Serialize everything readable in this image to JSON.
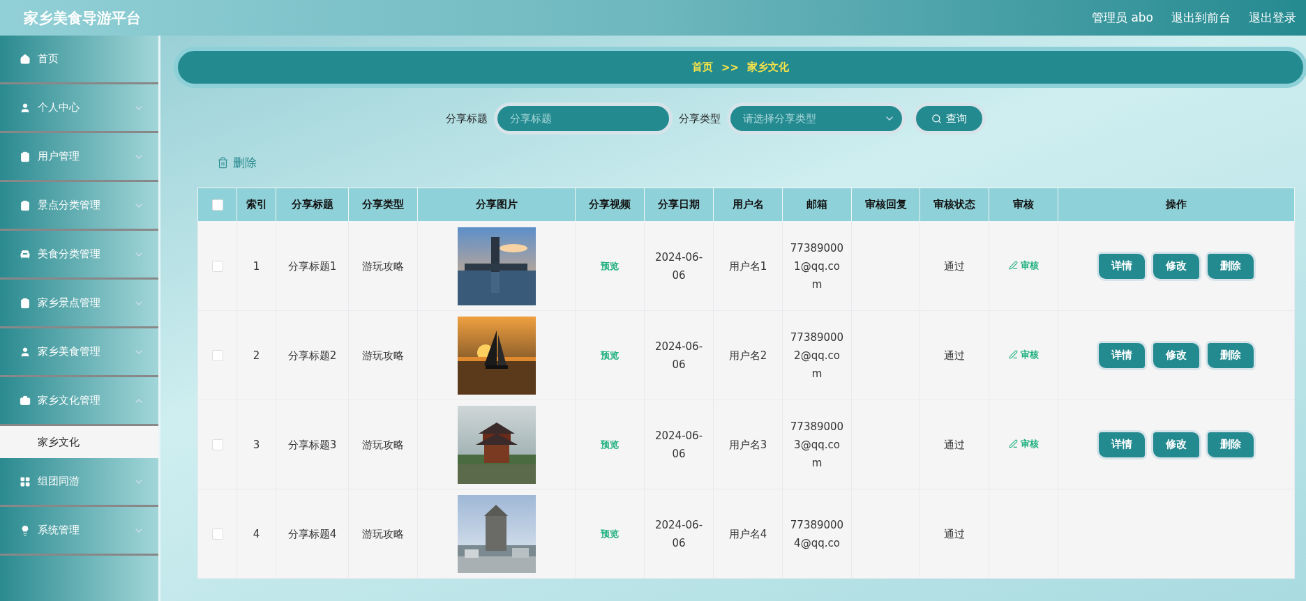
{
  "header": {
    "title": "家乡美食导游平台",
    "user": "管理员 abo",
    "links": [
      "退出到前台",
      "退出登录"
    ]
  },
  "sidebar": {
    "items": [
      {
        "label": "首页",
        "kind": "link",
        "selected": false
      },
      {
        "label": "个人中心",
        "kind": "menu",
        "expanded": false
      },
      {
        "label": "用户管理",
        "kind": "menu",
        "expanded": false
      },
      {
        "label": "景点分类管理",
        "kind": "menu",
        "expanded": false
      },
      {
        "label": "美食分类管理",
        "kind": "menu",
        "expanded": false
      },
      {
        "label": "家乡景点管理",
        "kind": "menu",
        "expanded": false
      },
      {
        "label": "家乡美食管理",
        "kind": "menu",
        "expanded": false
      },
      {
        "label": "家乡文化管理",
        "kind": "menu",
        "expanded": true,
        "children": [
          {
            "label": "家乡文化",
            "selected": true
          }
        ]
      },
      {
        "label": "组团同游",
        "kind": "menu",
        "expanded": false
      },
      {
        "label": "系统管理",
        "kind": "menu",
        "expanded": false
      }
    ]
  },
  "breadcrumb": {
    "home": "首页",
    "separator": ">>",
    "current": "家乡文化"
  },
  "search": {
    "title_label": "分享标题",
    "title_placeholder": "分享标题",
    "type_label": "分享类型",
    "type_placeholder": "请选择分享类型",
    "button": "查询"
  },
  "delete_button": "删除",
  "table": {
    "columns": [
      "索引",
      "分享标题",
      "分享类型",
      "分享图片",
      "分享视频",
      "分享日期",
      "用户名",
      "邮箱",
      "审核回复",
      "审核状态",
      "审核",
      "操作"
    ],
    "all_selected": false,
    "rows": [
      {
        "selected": false,
        "index": "1",
        "title": "分享标题1",
        "type": "游玩攻略",
        "video": "预览",
        "date": "2024-06-06",
        "user": "用户名1",
        "email": "773890001@qq.com",
        "reply": "",
        "status": "通过",
        "audit": "审核",
        "actions": [
          "详情",
          "修改",
          "删除"
        ]
      },
      {
        "selected": false,
        "index": "2",
        "title": "分享标题2",
        "type": "游玩攻略",
        "video": "预览",
        "date": "2024-06-06",
        "user": "用户名2",
        "email": "773890002@qq.com",
        "reply": "",
        "status": "通过",
        "audit": "审核",
        "actions": [
          "详情",
          "修改",
          "删除"
        ]
      },
      {
        "selected": false,
        "index": "3",
        "title": "分享标题3",
        "type": "游玩攻略",
        "video": "预览",
        "date": "2024-06-06",
        "user": "用户名3",
        "email": "773890003@qq.com",
        "reply": "",
        "status": "通过",
        "audit": "审核",
        "actions": [
          "详情",
          "修改",
          "删除"
        ]
      },
      {
        "selected": false,
        "index": "4",
        "title": "分享标题4",
        "type": "游玩攻略",
        "video": "预览",
        "date": "2024-06-06",
        "user": "用户名4",
        "email": "773890004@qq.co",
        "reply": "",
        "status": "通过"
      }
    ]
  }
}
